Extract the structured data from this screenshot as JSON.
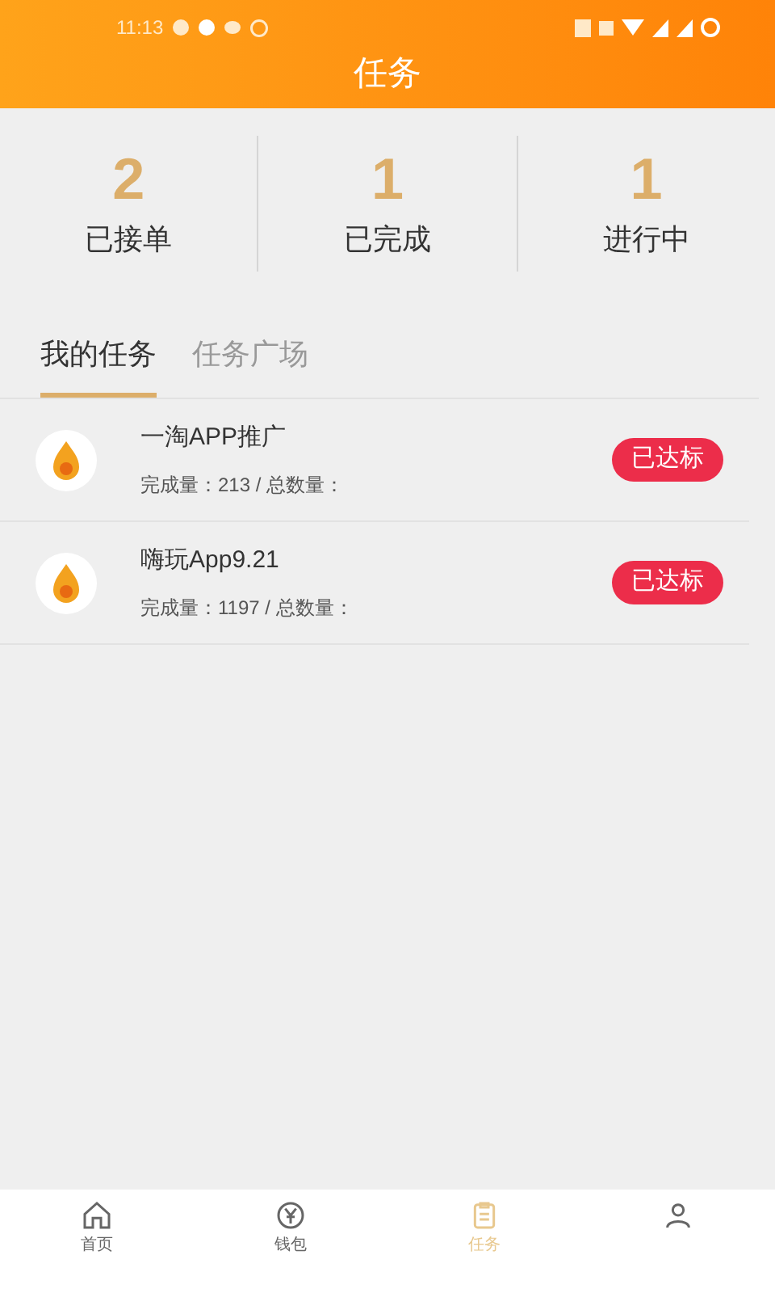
{
  "status_bar": {
    "time": "11:13"
  },
  "header": {
    "title": "任务"
  },
  "stats": [
    {
      "value": "2",
      "label": "已接单"
    },
    {
      "value": "1",
      "label": "已完成"
    },
    {
      "value": "1",
      "label": "进行中"
    }
  ],
  "tabs": [
    {
      "label": "我的任务",
      "selected": true
    },
    {
      "label": "任务广场",
      "selected": false
    }
  ],
  "tasks": [
    {
      "title": "一淘APP推广",
      "counts": "完成量：213 / 总数量：",
      "badge": "已达标"
    },
    {
      "title": "嗨玩App9.21",
      "counts": "完成量：1197 / 总数量：",
      "badge": "已达标"
    }
  ],
  "bottom_nav": [
    {
      "kind": "home",
      "label": "首页",
      "selected": false
    },
    {
      "kind": "wallet",
      "label": "钱包",
      "selected": false
    },
    {
      "kind": "task",
      "label": "任务",
      "selected": true
    },
    {
      "kind": "profile",
      "selected": false
    }
  ]
}
